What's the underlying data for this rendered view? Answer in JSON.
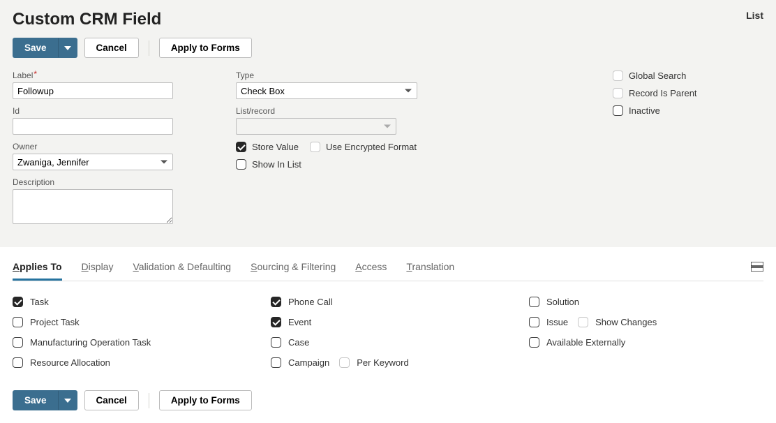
{
  "header": {
    "title": "Custom CRM Field",
    "list_link": "List"
  },
  "buttons": {
    "save": "Save",
    "cancel": "Cancel",
    "apply_to_forms": "Apply to Forms"
  },
  "form": {
    "label_field": {
      "label": "Label",
      "value": "Followup"
    },
    "id_field": {
      "label": "Id",
      "value": ""
    },
    "owner_field": {
      "label": "Owner",
      "value": "Zwaniga, Jennifer"
    },
    "description_field": {
      "label": "Description",
      "value": ""
    },
    "type_field": {
      "label": "Type",
      "value": "Check Box"
    },
    "listrecord_field": {
      "label": "List/record",
      "value": ""
    },
    "store_value": "Store Value",
    "use_encrypted": "Use Encrypted Format",
    "show_in_list": "Show In List",
    "global_search": "Global Search",
    "record_is_parent": "Record Is Parent",
    "inactive": "Inactive"
  },
  "tabs": {
    "applies_to": "pplies To",
    "display": "isplay",
    "validation": "alidation & Defaulting",
    "sourcing": "ourcing & Filtering",
    "access": "ccess",
    "translation": "ranslation"
  },
  "applies": {
    "task": "Task",
    "project_task": "Project Task",
    "manufacturing_op": "Manufacturing Operation Task",
    "resource_alloc": "Resource Allocation",
    "phone_call": "Phone Call",
    "event": "Event",
    "case": "Case",
    "campaign": "Campaign",
    "per_keyword": "Per Keyword",
    "solution": "Solution",
    "issue": "Issue",
    "show_changes": "Show Changes",
    "available_ext": "Available Externally"
  }
}
